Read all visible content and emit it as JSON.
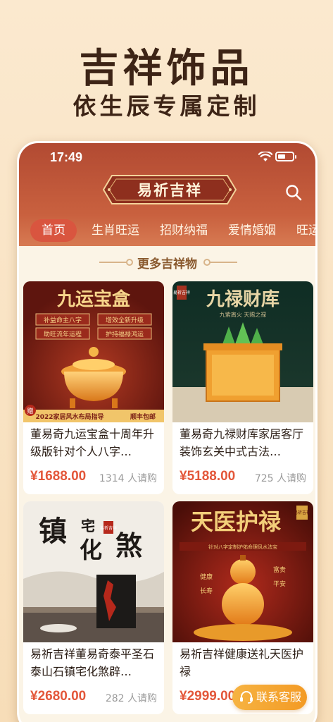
{
  "promo": {
    "title": "吉祥饰品",
    "subtitle": "依生辰专属定制"
  },
  "status_bar": {
    "time": "17:49"
  },
  "header": {
    "logo_text": "易祈吉祥",
    "search_icon": "search-icon"
  },
  "tabs": [
    {
      "label": "首页",
      "active": true
    },
    {
      "label": "生肖旺运",
      "active": false
    },
    {
      "label": "招财纳福",
      "active": false
    },
    {
      "label": "爱情婚姻",
      "active": false
    },
    {
      "label": "旺运",
      "active": false
    }
  ],
  "section": {
    "title": "更多吉祥物"
  },
  "products": [
    {
      "name": "董易奇九运宝盒十周年升级版针对个人八字…",
      "price": "¥1688.00",
      "sold": "1314 人请购",
      "image_texts": [
        "九运宝盒",
        "补益命主八字",
        "增效全新升级",
        "助旺流年运程",
        "护持福禄鸿运",
        "2022家居风水布局指导",
        "顺丰包邮",
        "赠"
      ]
    },
    {
      "name": "董易奇九禄财库家居客厅装饰玄关中式古法…",
      "price": "¥5188.00",
      "sold": "725 人请购",
      "image_texts": [
        "九禄财库",
        "九紫离火 天赐之禄",
        "易祈吉祥"
      ]
    },
    {
      "name": "易祈吉祥董易奇泰平圣石泰山石镇宅化煞辟…",
      "price": "¥2680.00",
      "sold": "282 人请购",
      "image_texts": [
        "镇",
        "宅",
        "化",
        "煞",
        "易祈吉祥"
      ]
    },
    {
      "name": "易祈吉祥健康送礼天医护禄",
      "price": "¥2999.00",
      "sold": "",
      "image_texts": [
        "天医护禄",
        "针对八字定制护佑命理风水法宝",
        "健康",
        "长寿",
        "富贵",
        "平安",
        "易祈吉祥"
      ]
    }
  ],
  "contact_button": {
    "label": "联系客服"
  },
  "colors": {
    "accent": "#d9553f",
    "price": "#e3573a",
    "header": "#b24a32",
    "contact": "#f39a24"
  }
}
